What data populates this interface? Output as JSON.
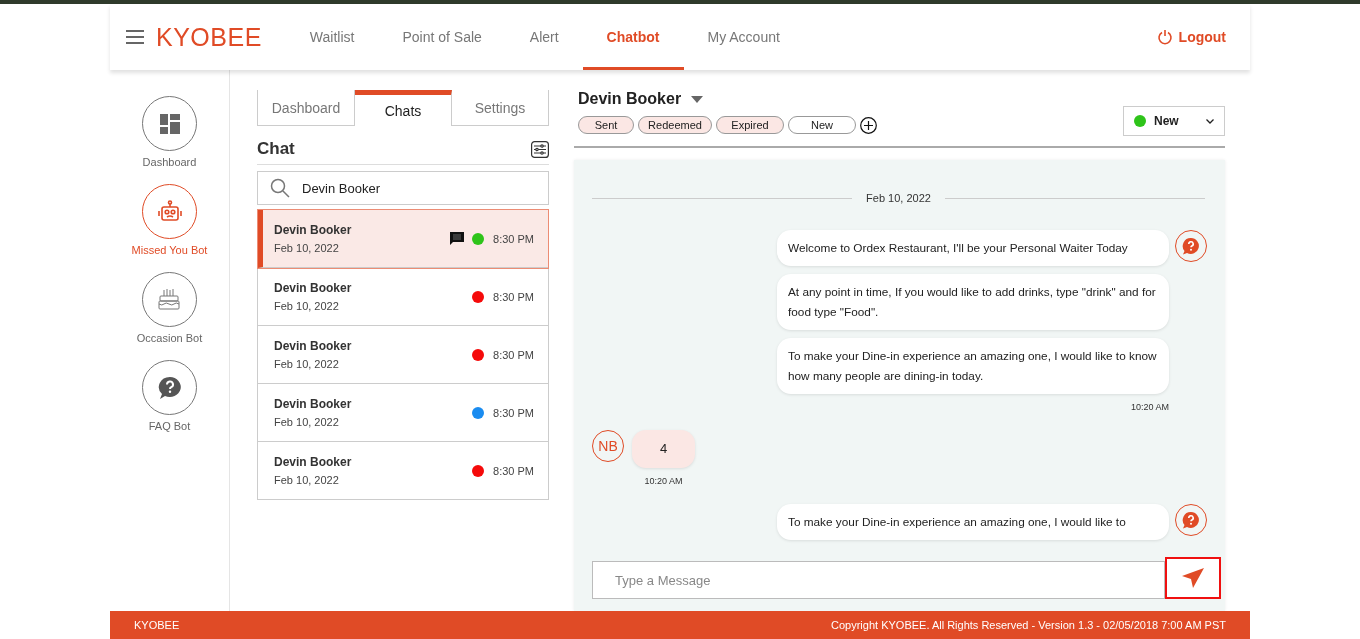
{
  "header": {
    "logo": "KYOBEE",
    "nav": [
      {
        "label": "Waitlist",
        "selected": false
      },
      {
        "label": "Point of Sale",
        "selected": false
      },
      {
        "label": "Alert",
        "selected": false
      },
      {
        "label": "Chatbot",
        "selected": true
      },
      {
        "label": "My Account",
        "selected": false
      }
    ],
    "logout": "Logout"
  },
  "sidebar": {
    "items": [
      {
        "kind": "dashboard",
        "label": "Dashboard",
        "selected": false
      },
      {
        "kind": "robot",
        "label": "Missed You Bot",
        "selected": true
      },
      {
        "kind": "cake",
        "label": "Occasion Bot",
        "selected": false
      },
      {
        "kind": "faq",
        "label": "FAQ Bot",
        "selected": false
      }
    ]
  },
  "chat_list": {
    "tabs": [
      {
        "label": "Dashboard",
        "selected": false
      },
      {
        "label": "Chats",
        "selected": true
      },
      {
        "label": "Settings",
        "selected": false
      }
    ],
    "title": "Chat",
    "search": {
      "value": "Devin Booker"
    },
    "items": [
      {
        "name": "Devin Booker",
        "date": "Feb 10, 2022",
        "time": "8:30 PM",
        "color": "#2ec41a",
        "selected": true,
        "has_message": true
      },
      {
        "name": "Devin Booker",
        "date": "Feb 10, 2022",
        "time": "8:30 PM",
        "color": "#f50a0a",
        "selected": false,
        "has_message": false
      },
      {
        "name": "Devin Booker",
        "date": "Feb 10, 2022",
        "time": "8:30 PM",
        "color": "#f50a0a",
        "selected": false,
        "has_message": false
      },
      {
        "name": "Devin Booker",
        "date": "Feb 10, 2022",
        "time": "8:30 PM",
        "color": "#1a8cf0",
        "selected": false,
        "has_message": false
      },
      {
        "name": "Devin Booker",
        "date": "Feb 10, 2022",
        "time": "8:30 PM",
        "color": "#f50a0a",
        "selected": false,
        "has_message": false
      }
    ]
  },
  "conversation": {
    "contact": "Devin Booker",
    "tags": [
      {
        "kind": "tag",
        "label": "Sent"
      },
      {
        "kind": "tag",
        "label": "Redeemed"
      },
      {
        "kind": "tag",
        "label": "Expired"
      },
      {
        "kind": "input",
        "label": "New"
      }
    ],
    "status": {
      "label": "New",
      "color": "#2ec41a"
    },
    "date": "Feb 10, 2022",
    "messages": [
      {
        "kind": "bot",
        "texts": [
          "Welcome to Ordex Restaurant, I'll be your Personal Waiter Today",
          "At any point in time, If you would like to add drinks, type \"drink\" and for food type \"Food\".",
          "To make your Dine-in experience an amazing one, I would like to know how many people are dining-in today."
        ],
        "time": "10:20 AM"
      },
      {
        "kind": "user",
        "avatar": "NB",
        "texts": [
          "4"
        ],
        "time": "10:20 AM"
      },
      {
        "kind": "bot",
        "texts": [
          "To make your Dine-in experience an amazing one, I would like to"
        ]
      }
    ],
    "composer": {
      "placeholder": "Type a Message"
    }
  },
  "footer": {
    "brand": "KYOBEE",
    "copyright": "Copyright KYOBEE. All Rights Reserved - Version 1.3 - 02/05/2018 7:00 AM PST"
  }
}
